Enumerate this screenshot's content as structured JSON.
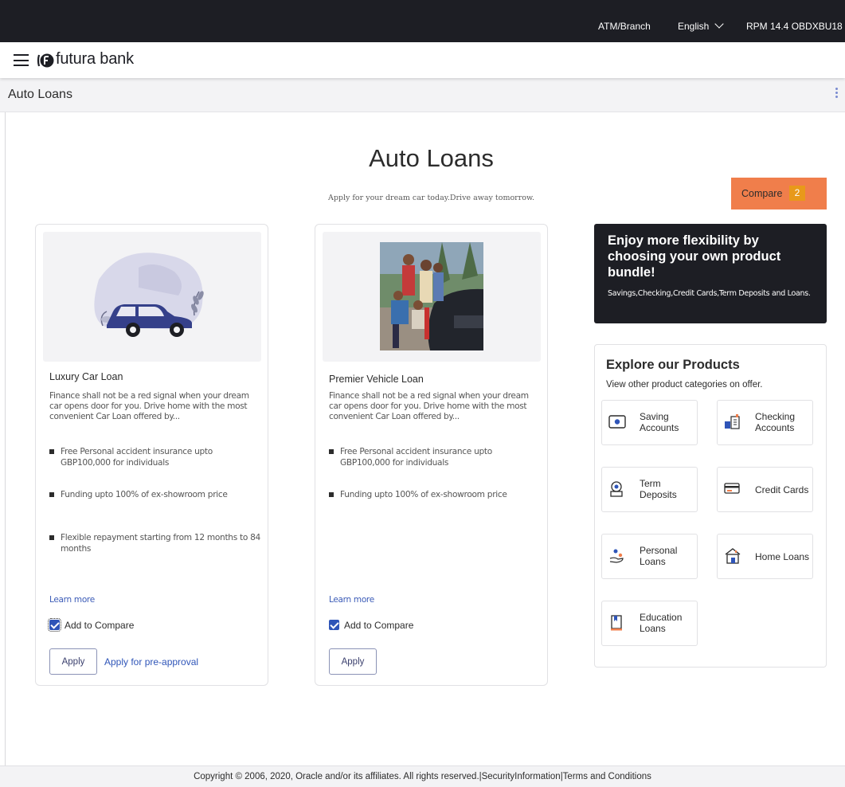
{
  "topbar": {
    "atm_branch": "ATM/Branch",
    "language": "English",
    "user": "RPM 14.4 OBDXBU18"
  },
  "brand": {
    "name": "futura bank"
  },
  "page": {
    "title": "Auto Loans"
  },
  "hero": {
    "title": "Auto Loans",
    "subtitle": "Apply for your dream car today.Drive away tomorrow."
  },
  "compare": {
    "label": "Compare",
    "count": "2"
  },
  "products": [
    {
      "name": "Luxury Car Loan",
      "description": "Finance shall not be a red signal when your dream car opens door for you. Drive home with the most convenient Car Loan offered by...",
      "features": [
        "Free Personal accident insurance upto GBP100,000 for individuals",
        "Funding upto 100% of ex-showroom price",
        "Flexible repayment starting from 12 months to 84 months"
      ],
      "learn_more": "Learn more",
      "add_to_compare": "Add to Compare",
      "apply": "Apply",
      "pre_approval": "Apply for pre-approval"
    },
    {
      "name": "Premier Vehicle Loan",
      "description": "Finance shall not be a red signal when your dream car opens door for you. Drive home with the most convenient Car Loan offered by...",
      "features": [
        "Free Personal accident insurance upto GBP100,000 for individuals",
        "Funding upto 100% of ex-showroom price"
      ],
      "learn_more": "Learn more",
      "add_to_compare": "Add to Compare",
      "apply": "Apply"
    }
  ],
  "promo": {
    "heading": "Enjoy more flexibility by choosing your own product bundle!",
    "text": "Savings,Checking,Credit Cards,Term Deposits and Loans."
  },
  "explore": {
    "heading": "Explore our Products",
    "subheading": "View other product categories on offer.",
    "tiles": [
      {
        "label_1": "Saving",
        "label_2": "Accounts",
        "icon": "saving-accounts-icon"
      },
      {
        "label_1": "Checking",
        "label_2": "Accounts",
        "icon": "checking-accounts-icon"
      },
      {
        "label_1": "Term",
        "label_2": "Deposits",
        "icon": "term-deposits-icon"
      },
      {
        "label_1": "Credit Cards",
        "label_2": "",
        "icon": "credit-cards-icon"
      },
      {
        "label_1": "Personal",
        "label_2": "Loans",
        "icon": "personal-loans-icon"
      },
      {
        "label_1": "Home Loans",
        "label_2": "",
        "icon": "home-loans-icon"
      },
      {
        "label_1": "Education",
        "label_2": "Loans",
        "icon": "education-loans-icon"
      }
    ]
  },
  "footer": {
    "text": "Copyright © 2006, 2020, Oracle and/or its affiliates. All rights reserved.|SecurityInformation|Terms and Conditions"
  },
  "colors": {
    "header_dark": "#1d1e24",
    "accent_orange": "#f07e4b",
    "badge_amber": "#e8991a",
    "link_blue": "#2f55b8"
  }
}
